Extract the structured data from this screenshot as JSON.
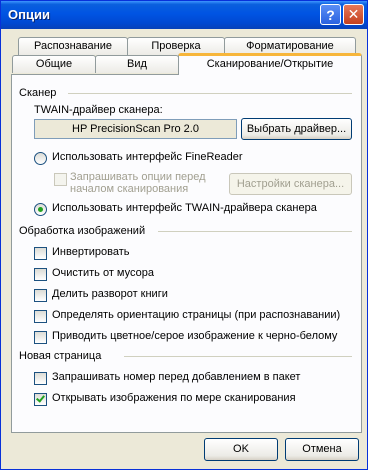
{
  "window": {
    "title": "Опции"
  },
  "titlebar": {
    "help_glyph": "?",
    "close_glyph": "✕"
  },
  "tabs": {
    "row1": [
      {
        "label": "Распознавание"
      },
      {
        "label": "Проверка"
      },
      {
        "label": "Форматирование"
      }
    ],
    "row2": [
      {
        "label": "Общие"
      },
      {
        "label": "Вид"
      },
      {
        "label": "Сканирование/Открытие",
        "active": true
      }
    ]
  },
  "scanner": {
    "group_label": "Сканер",
    "driver_label": "TWAIN-драйвер сканера:",
    "driver_value": "HP PrecisionScan Pro 2.0",
    "select_driver_button": "Выбрать драйвер...",
    "radio_finereader": {
      "label": "Использовать интерфейс FineReader",
      "selected": false
    },
    "ask_options": {
      "label_line1": "Запрашивать опции перед",
      "label_line2": "началом сканирования",
      "checked": false,
      "enabled": false
    },
    "scanner_settings_button": "Настройки сканера...",
    "radio_twain": {
      "label": "Использовать интерфейс TWAIN-драйвера сканера",
      "selected": true
    }
  },
  "image_processing": {
    "group_label": "Обработка изображений",
    "options": [
      {
        "label": "Инвертировать",
        "checked": false
      },
      {
        "label": "Очистить от мусора",
        "checked": false
      },
      {
        "label": "Делить разворот книги",
        "checked": false
      },
      {
        "label": "Определять ориентацию страницы (при  распознавании)",
        "checked": false
      },
      {
        "label": "Приводить цветное/серое изображение к черно-белому",
        "checked": false
      }
    ]
  },
  "new_page": {
    "group_label": "Новая страница",
    "options": [
      {
        "label": "Запрашивать номер перед добавлением в пакет",
        "checked": false
      },
      {
        "label": "Открывать изображения по мере сканирования",
        "checked": true
      }
    ]
  },
  "footer": {
    "ok": "OK",
    "cancel": "Отмена"
  }
}
